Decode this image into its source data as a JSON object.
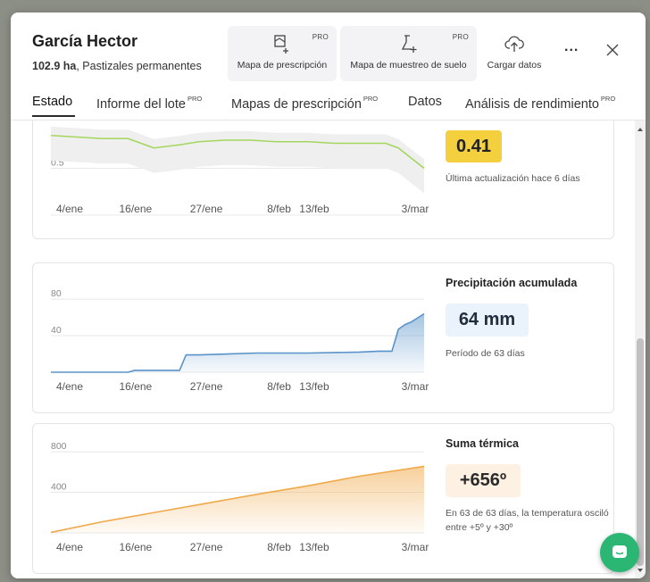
{
  "header": {
    "title": "García Hector",
    "area": "102.9 ha",
    "land_use": ", Pastizales permanentes"
  },
  "toolbar": {
    "prescription_map_label": "Mapa de prescripción",
    "soil_sampling_map_label": "Mapa de muestreo de suelo",
    "upload_label": "Cargar datos",
    "pro_badge": "PRO",
    "more_label": "..."
  },
  "tabs": [
    {
      "label": "Estado",
      "pro": ""
    },
    {
      "label": "Informe del lote",
      "pro": "PRO"
    },
    {
      "label": "Mapas de prescripción",
      "pro": "PRO"
    },
    {
      "label": "Datos",
      "pro": ""
    },
    {
      "label": "Análisis de rendimiento",
      "pro": "PRO"
    }
  ],
  "ndvi_card": {
    "value": "0.41",
    "note": "Última actualización hace 6 días",
    "value_bg": "#f4d03f"
  },
  "precip_card": {
    "title": "Precipitación acumulada",
    "value": "64 mm",
    "note": "Período de 63 días",
    "value_bg": "#eaf3fc"
  },
  "thermal_card": {
    "title": "Suma térmica",
    "value": "+656º",
    "note": "En 63 de 63 días, la temperatura osciló entre +5º y +30º",
    "value_bg": "#fdf1e3"
  },
  "colors": {
    "ndvi_line": "#a4d65e",
    "precip_line": "#5a93c9",
    "thermal_line": "#f0a94a",
    "chat_button": "#2bb673"
  },
  "chart_data": [
    {
      "type": "line",
      "x": [
        "4/ene",
        "8/ene",
        "12/ene",
        "16/ene",
        "20/ene",
        "24/ene",
        "27/ene",
        "31/ene",
        "4/feb",
        "8/feb",
        "13/feb",
        "17/feb",
        "21/feb",
        "25/feb",
        "27/feb",
        "3/mar"
      ],
      "values": [
        0.71,
        0.7,
        0.69,
        0.69,
        0.63,
        0.65,
        0.67,
        0.68,
        0.68,
        0.67,
        0.67,
        0.66,
        0.66,
        0.66,
        0.63,
        0.5
      ],
      "x_ticks": [
        "4/ene",
        "16/ene",
        "27/ene",
        "8/feb",
        "13/feb",
        "3/mar"
      ],
      "y_ticks": [
        0.5
      ],
      "ylim": [
        0.2,
        0.8
      ]
    },
    {
      "type": "area",
      "x": [
        "4/ene",
        "10/ene",
        "16/ene",
        "17/ene",
        "24/ene",
        "25/ene",
        "27/ene",
        "5/feb",
        "13/feb",
        "21/feb",
        "24/feb",
        "26/feb",
        "27/feb",
        "28/feb",
        "1/mar",
        "3/mar"
      ],
      "values": [
        0,
        0,
        0,
        2,
        2,
        19,
        19,
        21,
        21,
        22,
        23,
        23,
        47,
        52,
        55,
        64
      ],
      "x_ticks": [
        "4/ene",
        "16/ene",
        "27/ene",
        "8/feb",
        "13/feb",
        "3/mar"
      ],
      "y_ticks": [
        40,
        80
      ],
      "ylim": [
        0,
        85
      ]
    },
    {
      "type": "area",
      "x": [
        "4/ene",
        "12/ene",
        "20/ene",
        "28/ene",
        "5/feb",
        "13/feb",
        "21/feb",
        "3/mar"
      ],
      "values": [
        5,
        110,
        200,
        290,
        380,
        465,
        560,
        656
      ],
      "x_ticks": [
        "4/ene",
        "16/ene",
        "27/ene",
        "8/feb",
        "13/feb",
        "3/mar"
      ],
      "y_ticks": [
        400,
        800
      ],
      "ylim": [
        0,
        880
      ]
    }
  ]
}
